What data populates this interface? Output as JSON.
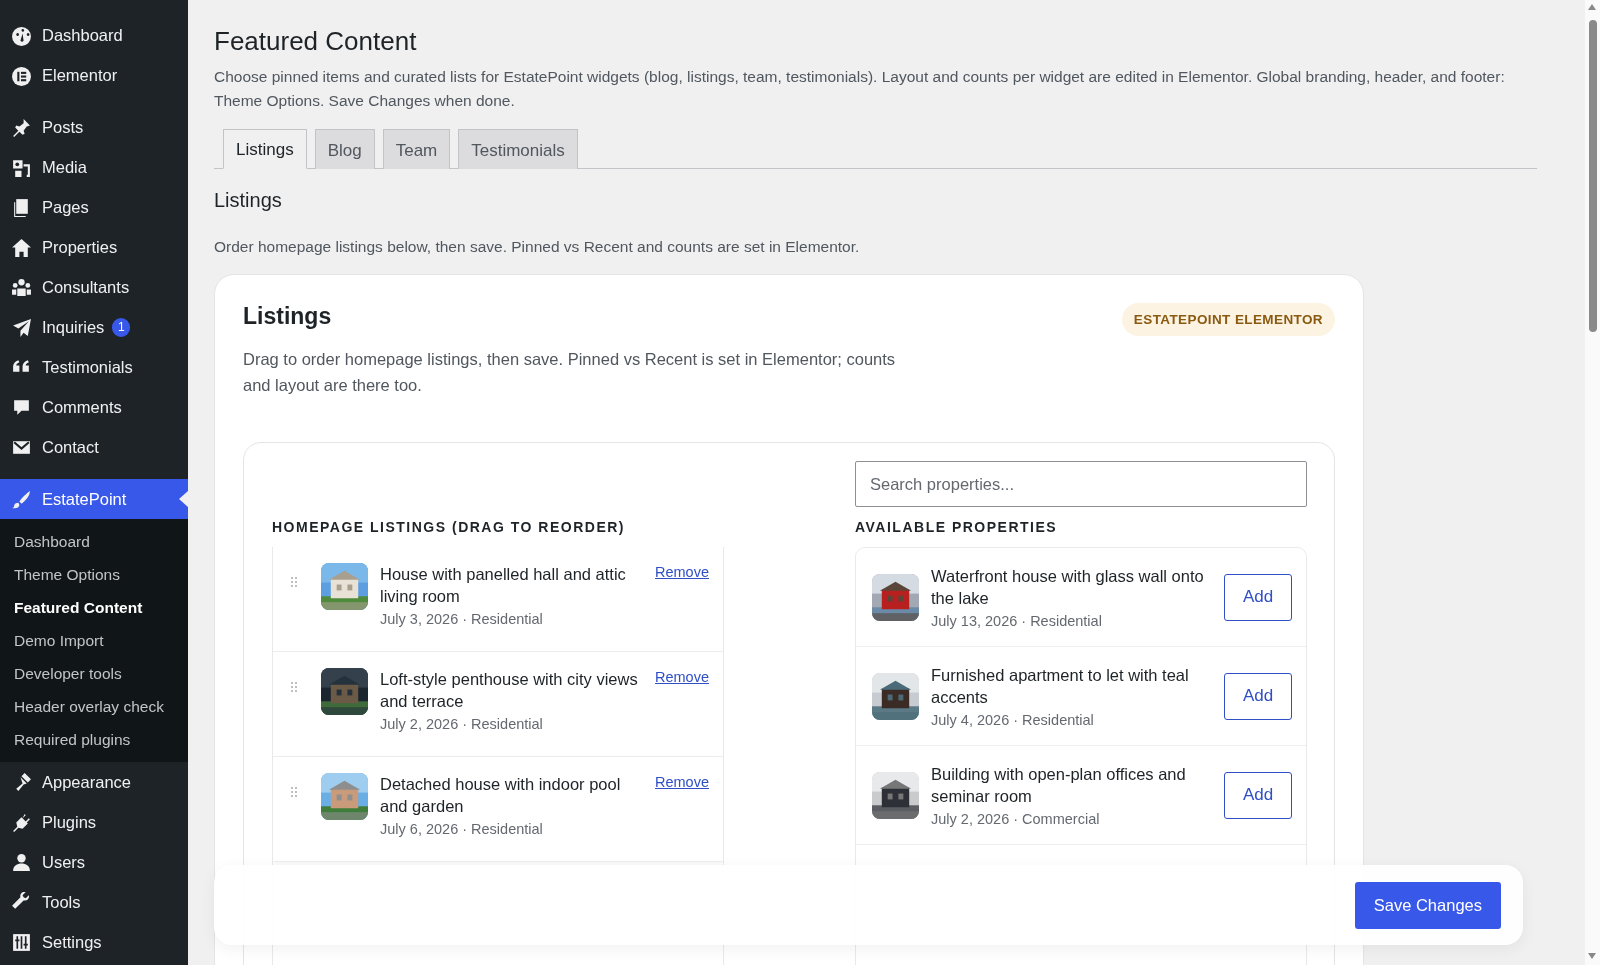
{
  "sidebar": {
    "sections": [
      [
        {
          "label": "Dashboard",
          "selected": false
        },
        {
          "label": "Elementor",
          "selected": false
        }
      ],
      [
        {
          "label": "Posts",
          "selected": false
        },
        {
          "label": "Media",
          "selected": false
        },
        {
          "label": "Pages",
          "selected": false
        },
        {
          "label": "Properties",
          "selected": false
        },
        {
          "label": "Consultants",
          "selected": false
        },
        {
          "label": "Inquiries",
          "selected": false,
          "badge": "1"
        },
        {
          "label": "Testimonials",
          "selected": false
        },
        {
          "label": "Comments",
          "selected": false
        },
        {
          "label": "Contact",
          "selected": false
        }
      ],
      [
        {
          "label": "EstatePoint",
          "selected": true,
          "children": [
            {
              "label": "Dashboard",
              "selected": false
            },
            {
              "label": "Theme Options",
              "selected": false
            },
            {
              "label": "Featured Content",
              "selected": true
            },
            {
              "label": "Demo Import",
              "selected": false
            },
            {
              "label": "Developer tools",
              "selected": false
            },
            {
              "label": "Header overlay check",
              "selected": false
            },
            {
              "label": "Required plugins",
              "selected": false
            }
          ]
        },
        {
          "label": "Appearance",
          "selected": false
        },
        {
          "label": "Plugins",
          "selected": false
        },
        {
          "label": "Users",
          "selected": false
        },
        {
          "label": "Tools",
          "selected": false
        },
        {
          "label": "Settings",
          "selected": false
        }
      ]
    ]
  },
  "page": {
    "title": "Featured Content",
    "description": "Choose pinned items and curated lists for EstatePoint widgets (blog, listings, team, testimonials). Layout and counts per widget are edited in Elementor. Global branding, header, and footer: Theme Options. Save Changes when done.",
    "tabs": [
      {
        "label": "Listings",
        "selected": true
      },
      {
        "label": "Blog",
        "selected": false
      },
      {
        "label": "Team",
        "selected": false
      },
      {
        "label": "Testimonials",
        "selected": false
      }
    ],
    "section_title": "Listings",
    "section_description": "Order homepage listings below, then save. Pinned vs Recent and counts are set in Elementor."
  },
  "card": {
    "title": "Listings",
    "badge": "ESTATEPOINT ELEMENTOR",
    "description": "Drag to order homepage listings, then save. Pinned vs Recent is set in Elementor; counts and layout are there too.",
    "homepage_listings": {
      "heading": "HOMEPAGE LISTINGS (DRAG TO REORDER)",
      "items": [
        {
          "title": "House with panelled hall and attic living room",
          "meta": "July 3, 2026 · Residential",
          "action": "Remove"
        },
        {
          "title": "Loft-style penthouse with city views and terrace",
          "meta": "July 2, 2026 · Residential",
          "action": "Remove"
        },
        {
          "title": "Detached house with indoor pool and garden",
          "meta": "July 6, 2026 · Residential",
          "action": "Remove"
        }
      ]
    },
    "available_properties": {
      "search_placeholder": "Search properties...",
      "heading": "AVAILABLE PROPERTIES",
      "items": [
        {
          "title": "Waterfront house with glass wall onto the lake",
          "meta": "July 13, 2026 · Residential",
          "action": "Add"
        },
        {
          "title": "Furnished apartment to let with teal accents",
          "meta": "July 4, 2026 · Residential",
          "action": "Add"
        },
        {
          "title": "Building with open-plan offices and seminar room",
          "meta": "July 2, 2026 · Commercial",
          "action": "Add"
        }
      ]
    }
  },
  "save_bar": {
    "button": "Save Changes"
  }
}
